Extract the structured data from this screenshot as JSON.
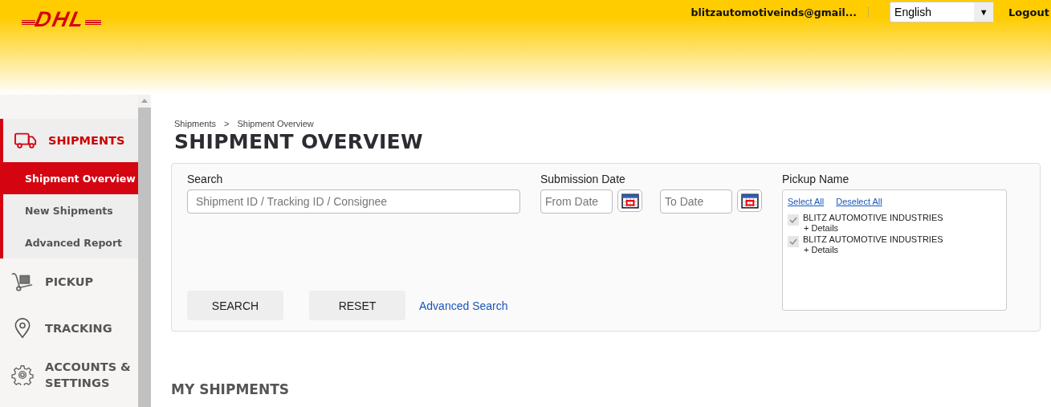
{
  "header": {
    "logo": "DHL",
    "user": "blitzautomotiveinds@gmail...",
    "language": "English",
    "language_caret": "▼",
    "logout": "Logout"
  },
  "sidebar": {
    "items": [
      {
        "label": "SHIPMENTS",
        "expanded": true,
        "children": [
          {
            "label": "Shipment Overview",
            "selected": true
          },
          {
            "label": "New Shipments",
            "selected": false
          },
          {
            "label": "Advanced Report",
            "selected": false
          }
        ]
      },
      {
        "label": "PICKUP",
        "expanded": false
      },
      {
        "label": "TRACKING",
        "expanded": false
      },
      {
        "label": "ACCOUNTS & SETTINGS",
        "expanded": false
      }
    ]
  },
  "breadcrumb": [
    "Shipments",
    ">",
    "Shipment Overview"
  ],
  "title": "SHIPMENT OVERVIEW",
  "search_panel": {
    "search_label": "Search",
    "search_placeholder": "Shipment ID / Tracking ID / Consignee",
    "date_label": "Submission Date",
    "from_placeholder": "From Date",
    "to_placeholder": "To Date",
    "pickup_label": "Pickup Name",
    "select_all": "Select All",
    "deselect_all": "Deselect All",
    "pickups": [
      {
        "name": "BLITZ AUTOMOTIVE INDUSTRIES",
        "details": "+ Details",
        "checked": true
      },
      {
        "name": "BLITZ AUTOMOTIVE INDUSTRIES",
        "details": "+ Details",
        "checked": true
      }
    ],
    "buttons": [
      "SEARCH",
      "RESET"
    ],
    "advanced_link": "Advanced Search"
  },
  "section_title": "MY SHIPMENTS"
}
